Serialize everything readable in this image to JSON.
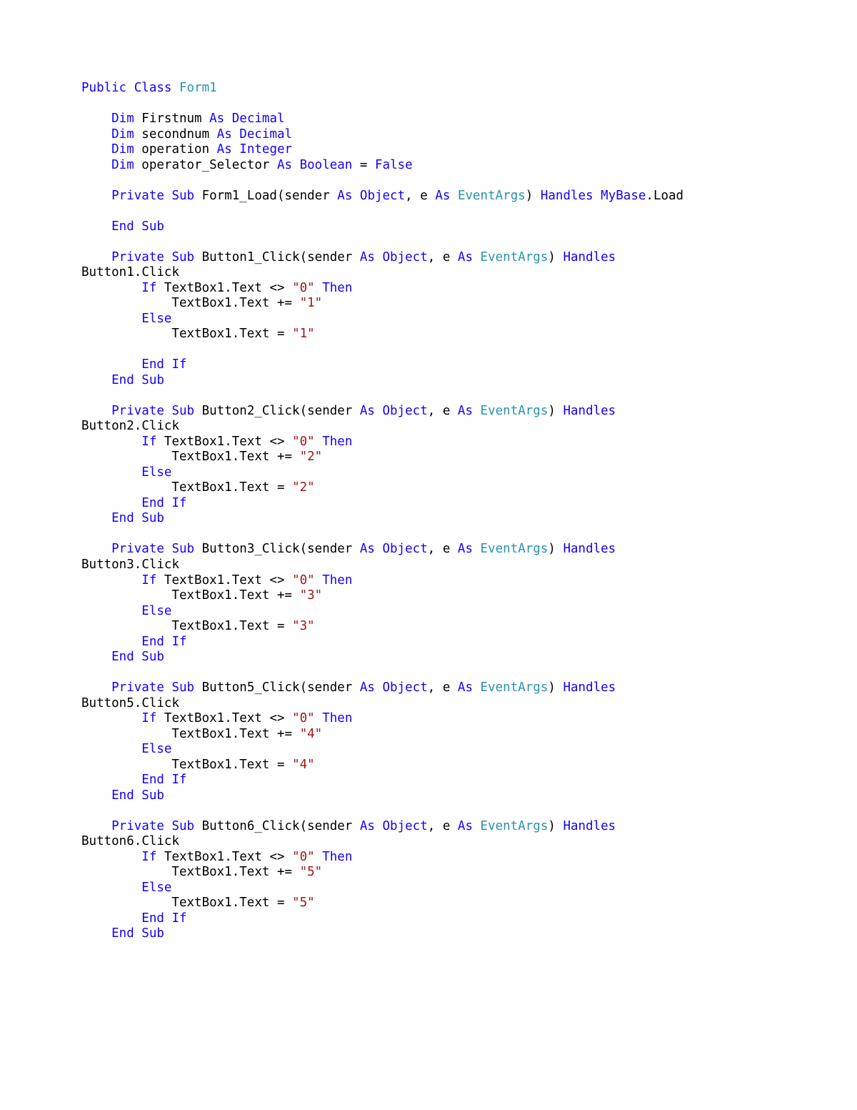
{
  "kw": {
    "Public": "Public",
    "Class": "Class",
    "Dim": "Dim",
    "As": "As",
    "Decimal": "Decimal",
    "Integer": "Integer",
    "Boolean": "Boolean",
    "False": "False",
    "Private": "Private",
    "Sub": "Sub",
    "Object": "Object",
    "Handles": "Handles",
    "MyBase": "MyBase",
    "End": "End",
    "If": "If",
    "Then": "Then",
    "Else": "Else"
  },
  "type": {
    "Form1": "Form1",
    "EventArgs": "EventArgs"
  },
  "id": {
    "Firstnum": "Firstnum",
    "secondnum": "secondnum",
    "operation": "operation",
    "operator_Selector": "operator_Selector",
    "Form1_Load": "Form1_Load",
    "Button1_Click": "Button1_Click",
    "Button2_Click": "Button2_Click",
    "Button3_Click": "Button3_Click",
    "Button5_Click": "Button5_Click",
    "Button6_Click": "Button6_Click",
    "Button1": "Button1",
    "Button2": "Button2",
    "Button3": "Button3",
    "Button5": "Button5",
    "Button6": "Button6",
    "TextBox1": "TextBox1",
    "Text": "Text",
    "Click": "Click",
    "Load": "Load",
    "sender": "sender",
    "e": "e"
  },
  "sym": {
    "eq": "=",
    "neq": "<>",
    "pluseq": "+=",
    "open": "(",
    "close": ")",
    "comma": ",",
    "dot": "."
  },
  "str": {
    "s0": "\"0\"",
    "s1": "\"1\"",
    "s2": "\"2\"",
    "s3": "\"3\"",
    "s4": "\"4\"",
    "s5": "\"5\""
  }
}
